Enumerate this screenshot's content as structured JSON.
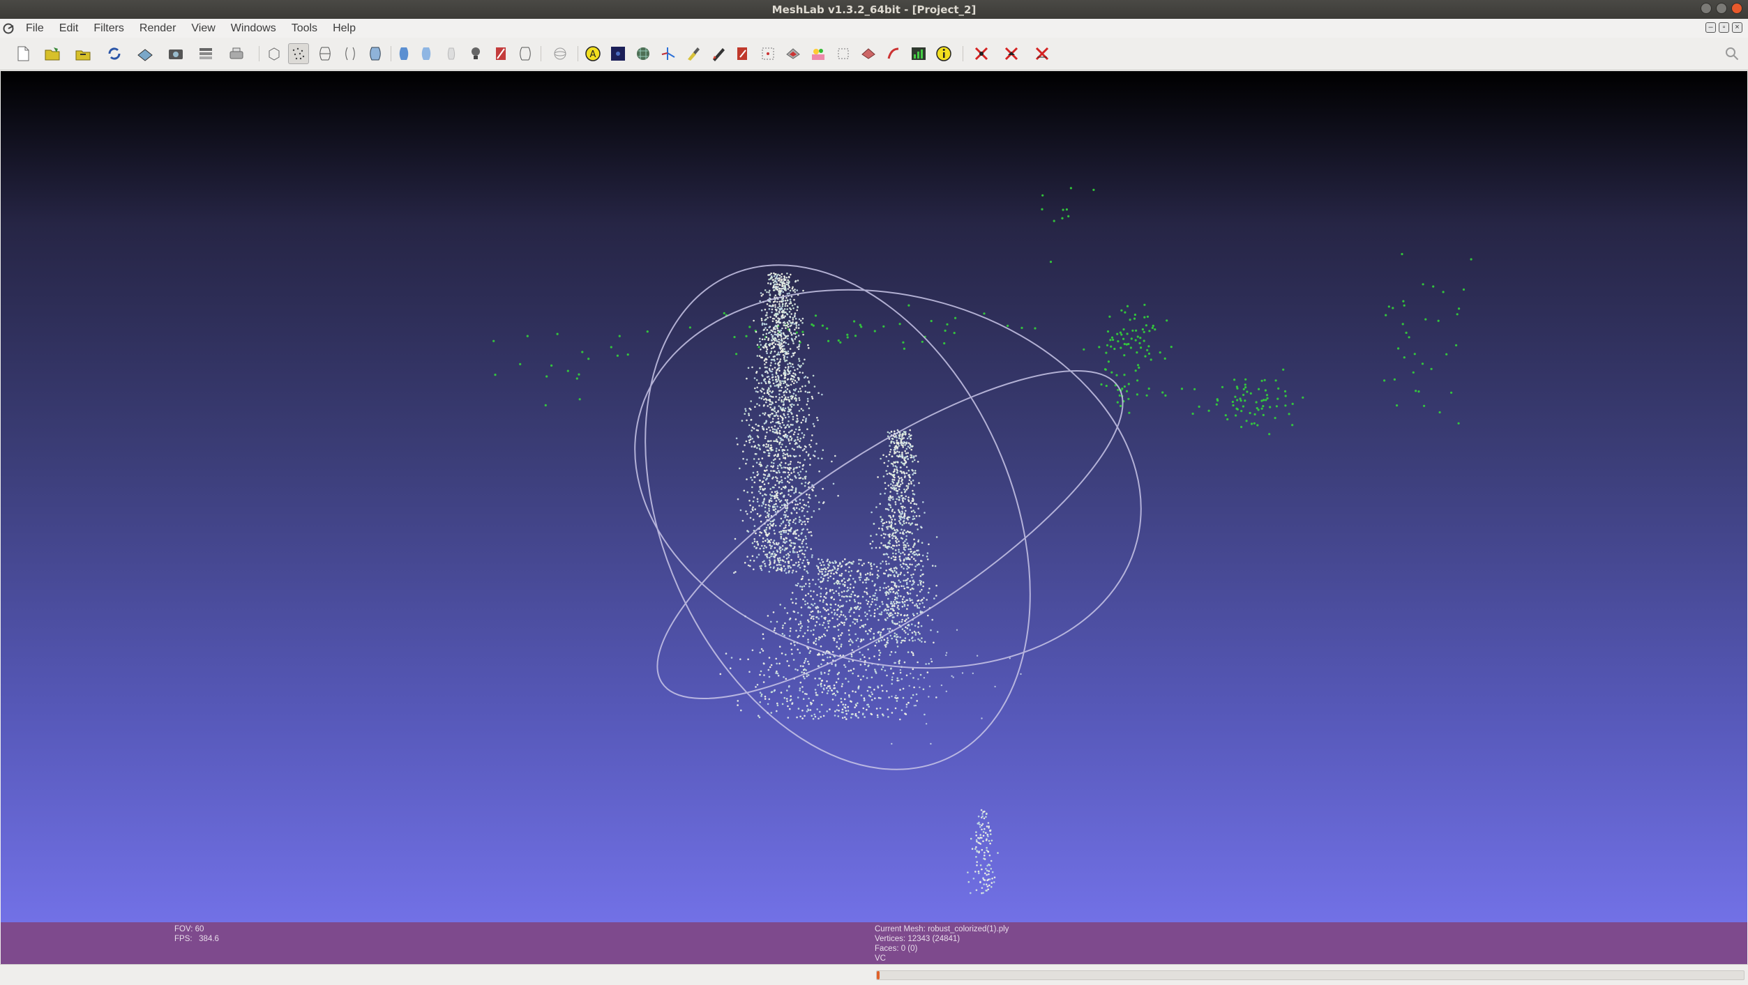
{
  "window": {
    "title": "MeshLab v1.3.2_64bit - [Project_2]"
  },
  "menu": {
    "items": [
      "File",
      "Edit",
      "Filters",
      "Render",
      "View",
      "Windows",
      "Tools",
      "Help"
    ]
  },
  "toolbar": {
    "icons": [
      "new-project-icon",
      "open-project-icon",
      "import-mesh-icon",
      "reload-icon",
      "export-mesh-icon",
      "snapshot-icon",
      "layers-icon",
      "print-icon",
      "bounding-box-icon",
      "points-icon",
      "wireframe-icon",
      "hidden-lines-icon",
      "flat-lines-icon",
      "flat-shading-icon",
      "smooth-shading-icon",
      "texture-icon",
      "light-icon",
      "backface-icon",
      "double-side-icon",
      "trackball-icon",
      "annotation-icon",
      "raster-icon",
      "align-icon",
      "measure-icon",
      "paint-icon",
      "pencil-icon",
      "color-picker-icon",
      "select-vertices-icon",
      "select-faces-icon",
      "select-connected-icon",
      "move-icon",
      "delete-selected-icon",
      "quality-map-icon",
      "histogram-icon",
      "info-icon",
      "delete-vertices-icon",
      "delete-faces-icon",
      "delete-all-icon"
    ],
    "active_icon": "points-icon"
  },
  "colors": {
    "info_bar": "#7e4a8d",
    "progress_accent": "#e0622b",
    "point_cloud_green": "#34d43a",
    "point_cloud_white": "#dfe8e6"
  },
  "info": {
    "fov_label": "FOV:",
    "fov_value": "60",
    "fps_label": "FPS:",
    "fps_value": "384.6",
    "current_mesh_label": "Current Mesh:",
    "current_mesh_value": "robust_colorized(1).ply",
    "vertices_label": "Vertices:",
    "vertices_value": "12343 (24841)",
    "faces_label": "Faces:",
    "faces_value": "0 (0)",
    "vc_label": "VC"
  },
  "status": {
    "progress_fraction": 0.003
  }
}
